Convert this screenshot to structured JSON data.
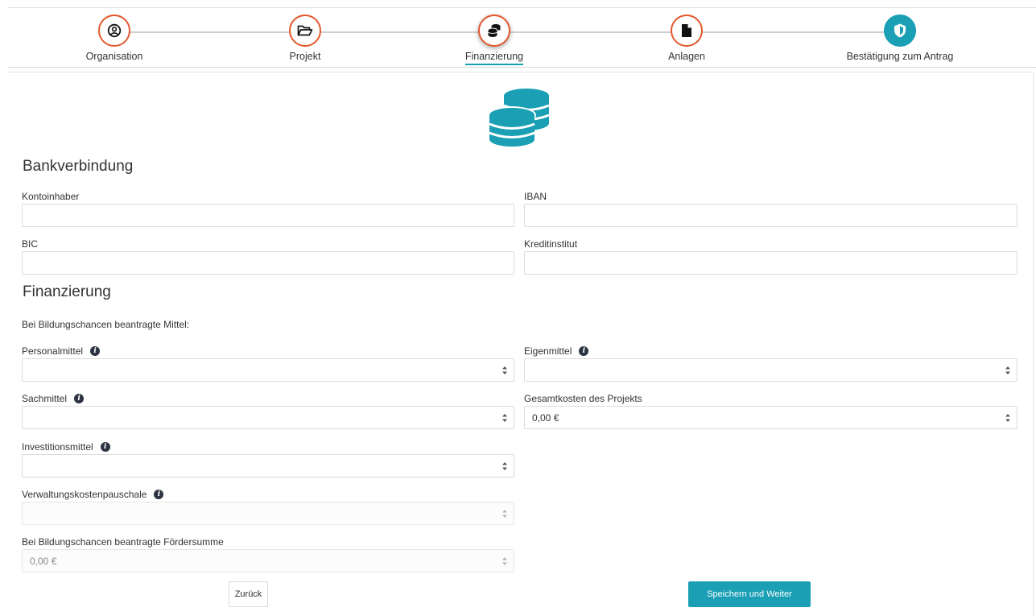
{
  "stepper": {
    "steps": [
      {
        "label": "Organisation",
        "icon": "user-circle-icon",
        "state": "done"
      },
      {
        "label": "Projekt",
        "icon": "folder-open-icon",
        "state": "done"
      },
      {
        "label": "Finanzierung",
        "icon": "coins-icon",
        "state": "active"
      },
      {
        "label": "Anlagen",
        "icon": "file-icon",
        "state": "todo"
      },
      {
        "label": "Bestätigung zum Antrag",
        "icon": "shield-icon",
        "state": "final"
      }
    ]
  },
  "colors": {
    "accent": "#1a9fb5",
    "step_border": "#e2582d",
    "text": "#333333"
  },
  "bank": {
    "title": "Bankverbindung",
    "account_holder_label": "Kontoinhaber",
    "account_holder_value": "",
    "iban_label": "IBAN",
    "iban_value": "",
    "bic_label": "BIC",
    "bic_value": "",
    "bank_label": "Kreditinstitut",
    "bank_value": ""
  },
  "finance": {
    "title": "Finanzierung",
    "intro": "Bei Bildungschancen beantragte Mittel:",
    "personnel_label": "Personalmittel",
    "personnel_value": "",
    "own_funds_label": "Eigenmittel",
    "own_funds_value": "",
    "material_label": "Sachmittel",
    "material_value": "",
    "total_label": "Gesamtkosten des Projekts",
    "total_value": "0,00 €",
    "investment_label": "Investitionsmittel",
    "investment_value": "",
    "admin_label": "Verwaltungskostenpauschale",
    "admin_value": "",
    "funding_sum_label": "Bei Bildungschancen beantragte Fördersumme",
    "funding_sum_value": "0,00 €"
  },
  "actions": {
    "back_label": "Zurück",
    "save_label": "Speichern und Weiter"
  }
}
